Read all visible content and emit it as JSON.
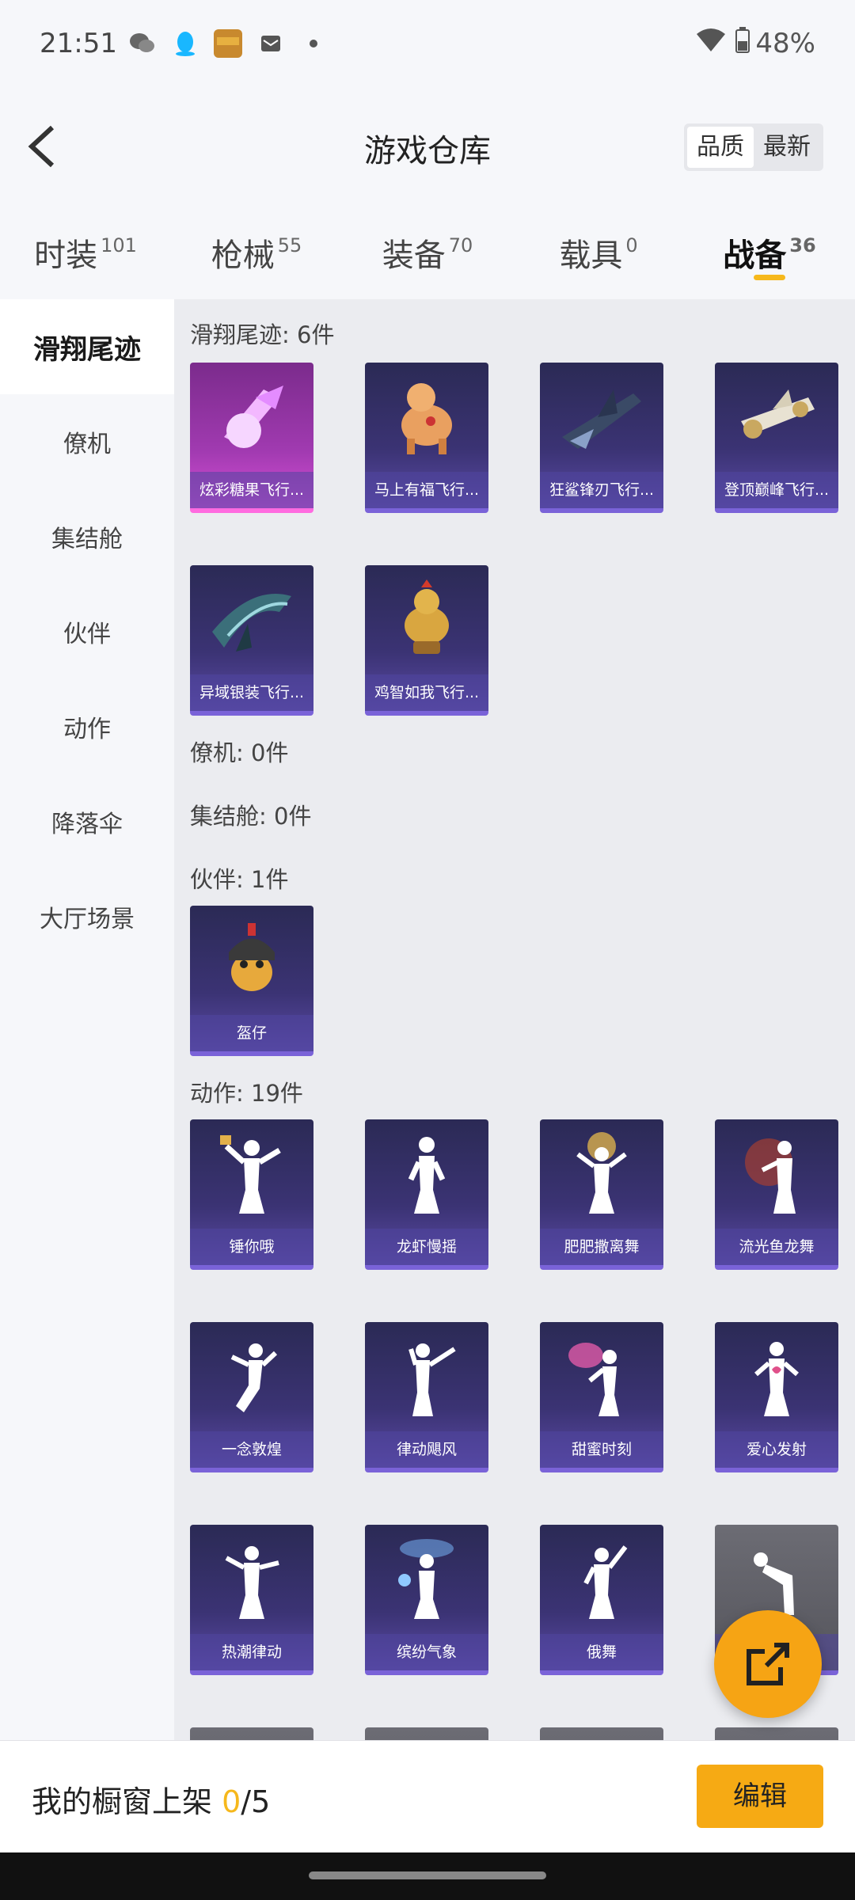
{
  "status_bar": {
    "time": "21:51",
    "battery": "48%"
  },
  "header": {
    "title": "游戏仓库",
    "sort_quality": "品质",
    "sort_newest": "最新"
  },
  "tabs": [
    {
      "label": "时装",
      "count": "101"
    },
    {
      "label": "枪械",
      "count": "55"
    },
    {
      "label": "装备",
      "count": "70"
    },
    {
      "label": "载具",
      "count": "0"
    },
    {
      "label": "战备",
      "count": "36"
    }
  ],
  "sidebar": {
    "items": [
      {
        "label": "滑翔尾迹"
      },
      {
        "label": "僚机"
      },
      {
        "label": "集结舱"
      },
      {
        "label": "伙伴"
      },
      {
        "label": "动作"
      },
      {
        "label": "降落伞"
      },
      {
        "label": "大厅场景"
      }
    ]
  },
  "sections": {
    "glide": {
      "title": "滑翔尾迹: 6件",
      "items": [
        "炫彩糖果飞行...",
        "马上有福飞行...",
        "狂鲨锋刃飞行...",
        "登顶巅峰飞行...",
        "异域银装飞行...",
        "鸡智如我飞行..."
      ]
    },
    "wingman": {
      "title": "僚机: 0件"
    },
    "capsule": {
      "title": "集结舱: 0件"
    },
    "partner": {
      "title": "伙伴: 1件",
      "items": [
        "盔仔"
      ]
    },
    "action": {
      "title": "动作: 19件",
      "items": [
        "锤你哦",
        "龙虾慢摇",
        "肥肥撒离舞",
        "流光鱼龙舞",
        "一念敦煌",
        "律动飓风",
        "甜蜜时刻",
        "爱心发射",
        "热潮律动",
        "缤纷气象",
        "俄舞",
        ""
      ]
    }
  },
  "bottom": {
    "prefix": "我的橱窗上架 ",
    "current": "0",
    "total": "/5",
    "edit": "编辑"
  },
  "colors": {
    "accent": "#f6b81c",
    "card_purple": "#3b3374",
    "card_pink": "#a03ab0"
  }
}
